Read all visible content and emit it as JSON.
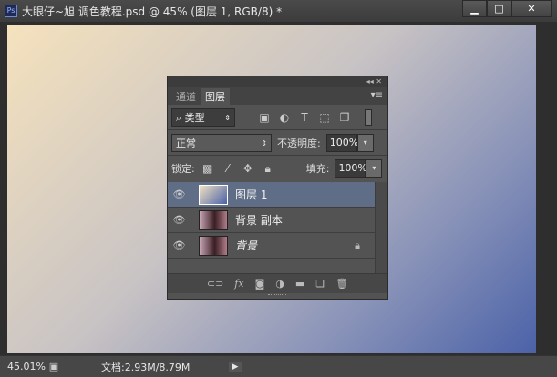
{
  "window": {
    "app_icon": "Ps",
    "title": "大眼仔~旭 调色教程.psd @ 45% (图层 1, RGB/8) *",
    "minimize": "▁",
    "maximize": "□",
    "close": "✕"
  },
  "panel": {
    "collapse": "◂◂",
    "close": "✕",
    "tabs": [
      {
        "label": "通道"
      },
      {
        "label": "图层"
      }
    ],
    "menu": "▾≡",
    "filter": {
      "label": "类型",
      "search_icon": "⌕",
      "icons": [
        "image-filter",
        "adjustment-filter",
        "T",
        "shape-filter",
        "smart-object-filter"
      ]
    },
    "blend_mode": "正常",
    "opacity_label": "不透明度:",
    "opacity": "100%",
    "lock_label": "锁定:",
    "fill_label": "填充:",
    "fill": "100%",
    "layers": [
      {
        "name": "图层 1",
        "selected": true
      },
      {
        "name": "背景 副本",
        "selected": false
      },
      {
        "name": "背景",
        "selected": false,
        "locked": true
      }
    ],
    "footer_fx": "fx"
  },
  "status": {
    "zoom": "45.01%",
    "doc": "文档:2.93M/8.79M",
    "arrow": "▶"
  },
  "colors": {
    "gradient_start": "#f5e2bd",
    "gradient_end": "#4b62a8",
    "selected_layer": "#5f6e86"
  }
}
